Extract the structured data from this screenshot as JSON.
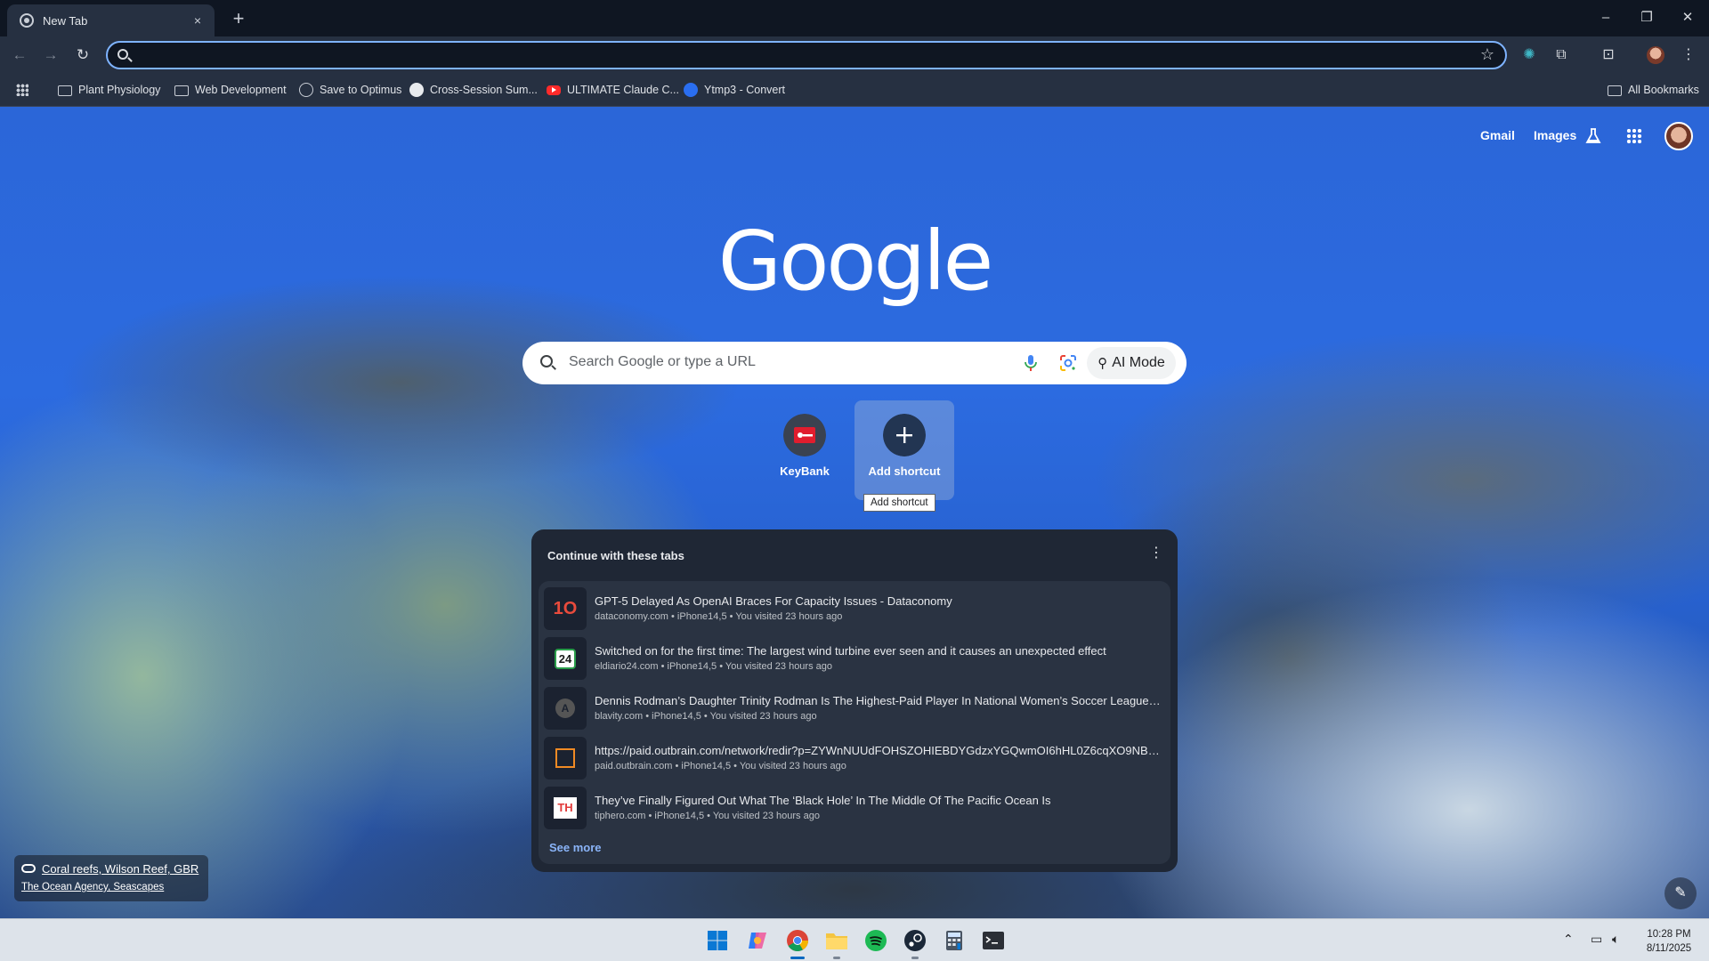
{
  "browser": {
    "tab": {
      "title": "New Tab",
      "close": "×"
    },
    "new_tab": "+",
    "window_controls": {
      "minimize": "–",
      "restore": "❐",
      "close": "✕"
    },
    "omnibox": {
      "value": "",
      "placeholder": ""
    },
    "bookmarks": [
      {
        "label": "Plant Physiology",
        "icon": "folder-icon"
      },
      {
        "label": "Web Development",
        "icon": "folder-icon"
      },
      {
        "label": "Save to Optimus",
        "icon": "globe-icon"
      },
      {
        "label": "Cross-Session Sum...",
        "icon": "github-icon"
      },
      {
        "label": "ULTIMATE Claude C...",
        "icon": "youtube-icon"
      },
      {
        "label": "Ytmp3 - Convert",
        "icon": "ytmp3-icon"
      }
    ],
    "all_bookmarks": "All Bookmarks"
  },
  "ntp": {
    "header_links": {
      "gmail": "Gmail",
      "images": "Images"
    },
    "logo": "Google",
    "search": {
      "placeholder": "Search Google or type a URL",
      "ai_mode": "AI Mode"
    },
    "shortcuts": [
      {
        "label": "KeyBank",
        "icon": "keybank-icon"
      },
      {
        "label": "Add shortcut",
        "icon": "plus-icon"
      }
    ],
    "tooltip": "Add shortcut",
    "continue_tabs": {
      "title": "Continue with these tabs",
      "items": [
        {
          "title": "GPT-5 Delayed As OpenAI Braces For Capacity Issues - Dataconomy",
          "meta": "dataconomy.com • iPhone14,5 • You visited 23 hours ago",
          "fav": "1O"
        },
        {
          "title": "Switched on for the first time: The largest wind turbine ever seen and it causes an unexpected effect",
          "meta": "eldiario24.com • iPhone14,5 • You visited 23 hours ago",
          "fav": "24"
        },
        {
          "title": "Dennis Rodman’s Daughter Trinity Rodman Is The Highest-Paid Player In National Women’s Soccer League - ...",
          "meta": "blavity.com • iPhone14,5 • You visited 23 hours ago",
          "fav": "A"
        },
        {
          "title": "https://paid.outbrain.com/network/redir?p=ZYWnNUUdFOHSZOHIEBDYGdzxYGQwmOI6hHL0Z6cqXO9NBP-...",
          "meta": "paid.outbrain.com • iPhone14,5 • You visited 23 hours ago",
          "fav": ""
        },
        {
          "title": "They’ve Finally Figured Out What The ‘Black Hole’ In The Middle Of The Pacific Ocean Is",
          "meta": "tiphero.com • iPhone14,5 • You visited 23 hours ago",
          "fav": "TH"
        }
      ],
      "see_more": "See more"
    },
    "attribution": {
      "title": "Coral reefs, Wilson Reef, GBR",
      "credit": "The Ocean Agency, Seascapes"
    }
  },
  "taskbar": {
    "apps": [
      "windows-start-icon",
      "copilot-icon",
      "chrome-icon",
      "file-explorer-icon",
      "spotify-icon",
      "steam-icon",
      "calculator-icon",
      "terminal-icon"
    ],
    "time": "10:28 PM",
    "date": "8/11/2025"
  },
  "colors": {
    "accent": "#8ab4f8",
    "omnibox_focus": "#7eb3ff",
    "taskbar_active": "#0067c0"
  }
}
